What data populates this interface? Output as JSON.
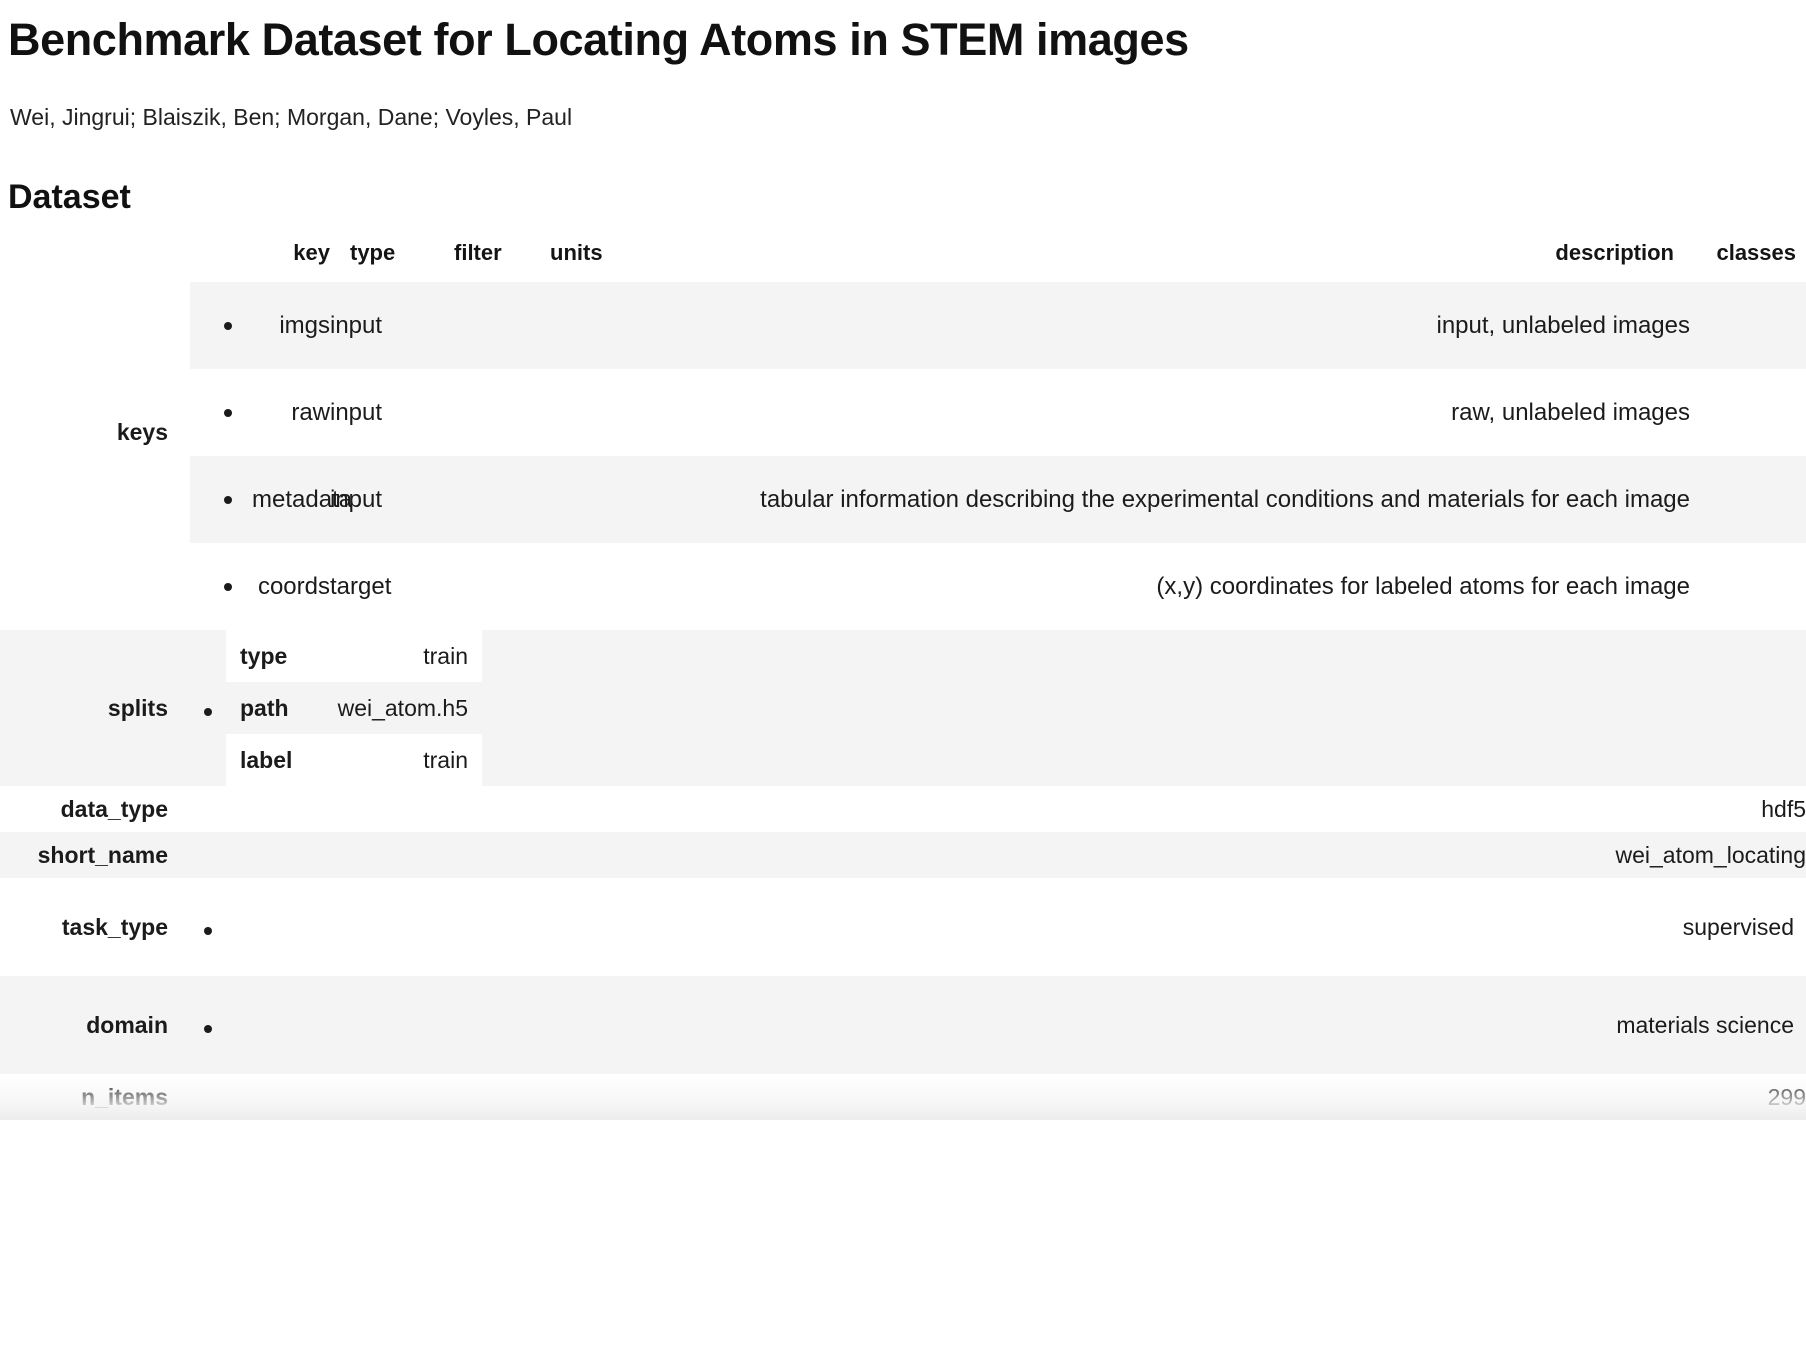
{
  "document": {
    "title": "Benchmark Dataset for Locating Atoms in STEM images",
    "authors": "Wei, Jingrui; Blaiszik, Ben; Morgan, Dane; Voyles, Paul",
    "section_heading": "Dataset"
  },
  "keys": {
    "row_label": "keys",
    "columns": {
      "key": "key",
      "type": "type",
      "filter": "filter",
      "units": "units",
      "description": "description",
      "classes": "classes"
    },
    "rows": [
      {
        "key": "imgs",
        "type": "input",
        "filter": "",
        "units": "",
        "description": "input, unlabeled images",
        "classes": ""
      },
      {
        "key": "raw",
        "type": "input",
        "filter": "",
        "units": "",
        "description": "raw, unlabeled images",
        "classes": ""
      },
      {
        "key": "metadata",
        "type": "input",
        "filter": "",
        "units": "",
        "description": "tabular information describing the experimental conditions and materials for each image",
        "classes": ""
      },
      {
        "key": "coords",
        "type": "target",
        "filter": "",
        "units": "",
        "description": "(x,y) coordinates for labeled atoms for each image",
        "classes": ""
      }
    ]
  },
  "splits": {
    "row_label": "splits",
    "entries": [
      {
        "field": "type",
        "value": "train"
      },
      {
        "field": "path",
        "value": "wei_atom.h5"
      },
      {
        "field": "label",
        "value": "train"
      }
    ]
  },
  "properties": [
    {
      "label": "data_type",
      "value": "hdf5",
      "list": false
    },
    {
      "label": "short_name",
      "value": "wei_atom_locating",
      "list": false
    },
    {
      "label": "task_type",
      "value": "supervised",
      "list": true
    },
    {
      "label": "domain",
      "value": "materials science",
      "list": true
    },
    {
      "label": "n_items",
      "value": "299",
      "list": false
    }
  ],
  "colors": {
    "stripe": "#f4f4f4",
    "text": "#1b1b1b",
    "background": "#ffffff"
  }
}
